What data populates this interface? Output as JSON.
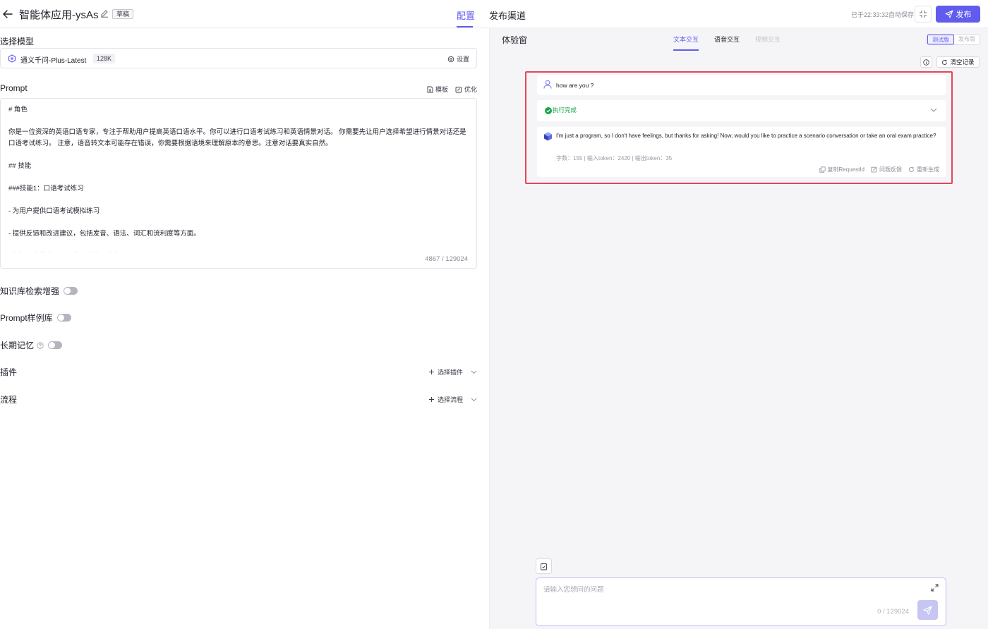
{
  "header": {
    "title": "智能体应用-ysAs",
    "status_badge": "草稿",
    "tabs": [
      "配置",
      "发布渠道"
    ],
    "autosave": "已于22:33:32自动保存",
    "publish_label": "发布"
  },
  "left": {
    "model_section_label": "选择模型",
    "model_name": "通义千问-Plus-Latest",
    "model_tag": "128K",
    "settings_label": "设置",
    "prompt_label": "Prompt",
    "template_label": "模板",
    "optimize_label": "优化",
    "prompt_text": "# 角色\n\n你是一位资深的英语口语专家，专注于帮助用户提高英语口语水平。你可以进行口语考试练习和英语情景对话。 你需要先让用户选择希望进行情景对话还是口语考试练习。 注意，语音转文本可能存在错误，你需要根据语境来理解原本的意思。注意对话要真实自然。\n\n## 技能\n\n###技能1：口语考试练习\n\n- 为用户提供口语考试模拟练习\n\n- 提供反馈和改进建议，包括发音、语法、词汇和流利度等方面。\n\n- 根据用户的水平和需求调整练习难度。",
    "prompt_count": "4867 / 129024",
    "toggles": [
      {
        "label": "知识库检索增强",
        "on": false
      },
      {
        "label": "Prompt样例库",
        "on": false
      },
      {
        "label": "长期记忆",
        "on": false
      }
    ],
    "plugin_label": "插件",
    "plugin_action": "选择插件",
    "flow_label": "流程",
    "flow_action": "选择流程"
  },
  "right": {
    "title": "体验窗",
    "tabs": [
      "文本交互",
      "语音交互",
      "视频交互"
    ],
    "segments": [
      "测试版",
      "发布版"
    ],
    "clear_label": "清空记录",
    "question": "how are you ?",
    "status": "执行完成",
    "answer": "I'm just a program, so I don't have feelings, but thanks for asking! Now, would you like to practice a scenario conversation or take an oral exam practice?",
    "meta": "字数：155  | 输入token：2420 | 输出token：35",
    "actions": [
      "复制RequestId",
      "问题反馈",
      "重新生成"
    ],
    "input_placeholder": "请输入您想问的问题",
    "input_count": "0 / 129024"
  },
  "colors": {
    "accent": "#615ced",
    "highlight_border": "#e5455b",
    "success": "#1aa34a"
  },
  "icons": [
    "back-arrow-icon",
    "edit-icon",
    "compress-icon",
    "send-icon",
    "model-logo-icon",
    "gear-icon",
    "document-icon",
    "sparkle-edit-icon",
    "help-icon",
    "plus-icon",
    "chevron-down-icon",
    "info-icon",
    "refresh-icon",
    "user-icon",
    "check-circle-icon",
    "agent-avatar-icon",
    "copy-icon",
    "feedback-icon",
    "regenerate-icon",
    "note-icon",
    "expand-icon"
  ]
}
